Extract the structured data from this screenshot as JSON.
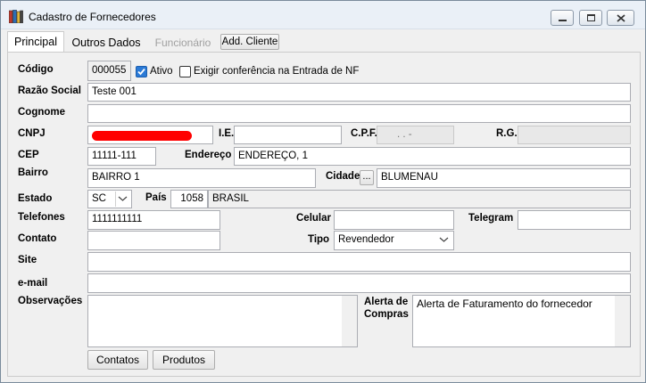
{
  "window": {
    "title": "Cadastro de Fornecedores"
  },
  "tabs": [
    {
      "label": "Principal",
      "state": "active"
    },
    {
      "label": "Outros Dados",
      "state": "normal"
    },
    {
      "label": "Funcionário",
      "state": "disabled"
    }
  ],
  "add_cliente_label": "Add. Cliente",
  "labels": {
    "codigo": "Código",
    "ativo": "Ativo",
    "exigir": "Exigir conferência na Entrada de NF",
    "razao_social": "Razão Social",
    "cognome": "Cognome",
    "cnpj": "CNPJ",
    "ie": "I.E.",
    "cpf": "C.P.F.",
    "rg": "R.G.",
    "cep": "CEP",
    "endereco": "Endereço",
    "bairro": "Bairro",
    "cidade": "Cidade",
    "estado": "Estado",
    "pais": "País",
    "telefones": "Telefones",
    "celular": "Celular",
    "telegram": "Telegram",
    "contato": "Contato",
    "tipo": "Tipo",
    "site": "Site",
    "email": "e-mail",
    "observacoes": "Observações",
    "alerta_compras_1": "Alerta de",
    "alerta_compras_2": "Compras"
  },
  "values": {
    "codigo": "000055",
    "ativo_checked": true,
    "exigir_checked": false,
    "razao_social": "Teste 001",
    "cognome": "",
    "ie": "",
    "cpf": ". . -",
    "rg": "",
    "cep": "11111-111",
    "endereco": "ENDEREÇO, 1",
    "bairro": "BAIRRO 1",
    "cidade_button": "...",
    "cidade": "BLUMENAU",
    "estado": "SC",
    "pais_codigo": "1058",
    "pais_nome": "BRASIL",
    "telefones": "1111111111",
    "celular": "",
    "telegram": "",
    "contato": "",
    "tipo": "Revendedor",
    "site": "",
    "email": "",
    "observacoes": "",
    "alerta_compras": "Alerta de Faturamento do fornecedor"
  },
  "buttons": {
    "contatos": "Contatos",
    "produtos": "Produtos"
  },
  "icons": {
    "app": "books-icon",
    "minimize": "minimize-icon",
    "maximize": "maximize-icon",
    "close": "close-icon",
    "check": "check-icon",
    "dropdown": "chevron-down-icon"
  },
  "colors": {
    "redaction": "#ff0000",
    "checkbox_accent": "#2b7ad6"
  }
}
